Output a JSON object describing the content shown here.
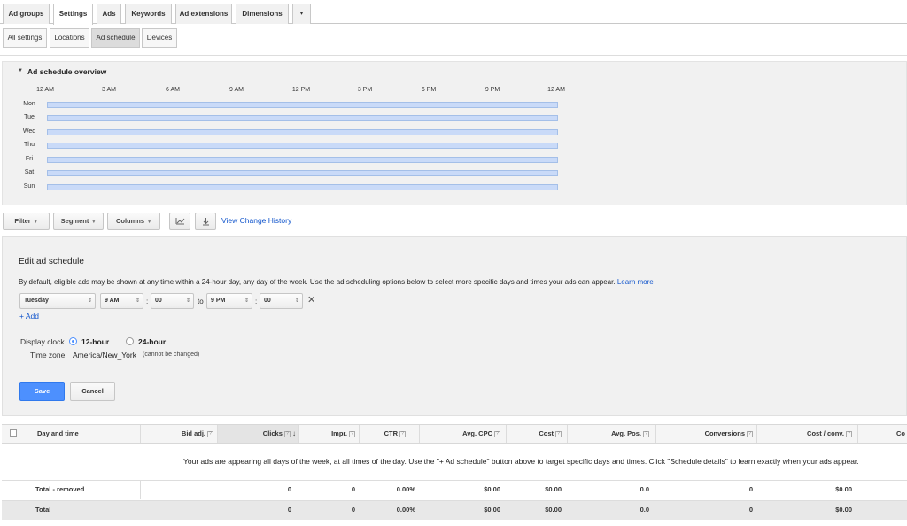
{
  "top_tabs": [
    "Ad groups",
    "Settings",
    "Ads",
    "Keywords",
    "Ad extensions",
    "Dimensions",
    "▾"
  ],
  "sub_tabs": [
    "All settings",
    "Locations",
    "Ad schedule",
    "Devices"
  ],
  "overview": {
    "title": "Ad schedule overview",
    "time_labels": [
      "12 AM",
      "3 AM",
      "6 AM",
      "9 AM",
      "12 PM",
      "3 PM",
      "6 PM",
      "9 PM",
      "12 AM"
    ],
    "days": [
      "Mon",
      "Tue",
      "Wed",
      "Thu",
      "Fri",
      "Sat",
      "Sun"
    ]
  },
  "toolbar": {
    "filter": "Filter",
    "segment": "Segment",
    "columns": "Columns",
    "history_link": "View Change History"
  },
  "edit": {
    "title": "Edit ad schedule",
    "description": "By default, eligible ads may be shown at any time within a 24-hour day, any day of the week. Use the ad scheduling options below to select more specific days and times your ads can appear.",
    "learn_more": "Learn more",
    "day": "Tuesday",
    "start_hour": "9 AM",
    "start_min": "00",
    "to": "to",
    "end_hour": "9 PM",
    "end_min": "00",
    "colon": ":",
    "add": "+ Add",
    "display_clock": "Display clock",
    "clock_12": "12-hour",
    "clock_24": "24-hour",
    "timezone_label": "Time zone",
    "timezone_value": "America/New_York",
    "timezone_note": "(cannot be changed)",
    "save": "Save",
    "cancel": "Cancel"
  },
  "table": {
    "headers": {
      "day_time": "Day and time",
      "bid_adj": "Bid adj.",
      "clicks": "Clicks",
      "impr": "Impr.",
      "ctr": "CTR",
      "avg_cpc": "Avg. CPC",
      "cost": "Cost",
      "avg_pos": "Avg. Pos.",
      "conversions": "Conversions",
      "cost_conv": "Cost / conv.",
      "conv_rate": "Co"
    },
    "message": "Your ads are appearing all days of the week, at all times of the day. Use the \"+ Ad schedule\" button above to target specific days and times. Click \"Schedule details\" to learn exactly when your ads appear.",
    "rows": [
      {
        "label": "Total - removed",
        "clicks": "0",
        "impr": "0",
        "ctr": "0.00%",
        "avg_cpc": "$0.00",
        "cost": "$0.00",
        "avg_pos": "0.0",
        "conversions": "0",
        "cost_conv": "$0.00"
      },
      {
        "label": "Total",
        "clicks": "0",
        "impr": "0",
        "ctr": "0.00%",
        "avg_cpc": "$0.00",
        "cost": "$0.00",
        "avg_pos": "0.0",
        "conversions": "0",
        "cost_conv": "$0.00"
      }
    ]
  }
}
